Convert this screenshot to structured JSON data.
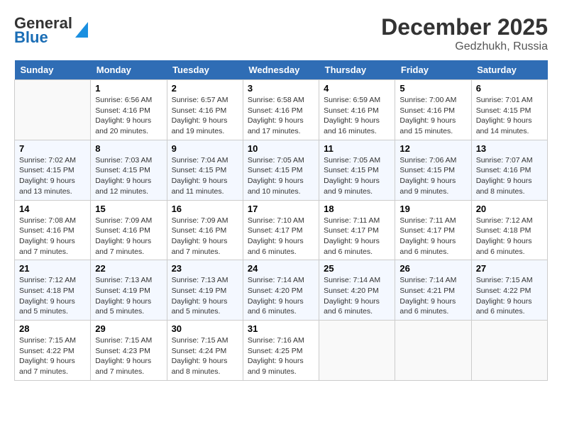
{
  "header": {
    "logo_line1": "General",
    "logo_line2": "Blue",
    "month": "December 2025",
    "location": "Gedzhukh, Russia"
  },
  "weekdays": [
    "Sunday",
    "Monday",
    "Tuesday",
    "Wednesday",
    "Thursday",
    "Friday",
    "Saturday"
  ],
  "weeks": [
    [
      {
        "date": "",
        "sunrise": "",
        "sunset": "",
        "daylight": ""
      },
      {
        "date": "1",
        "sunrise": "Sunrise: 6:56 AM",
        "sunset": "Sunset: 4:16 PM",
        "daylight": "Daylight: 9 hours and 20 minutes."
      },
      {
        "date": "2",
        "sunrise": "Sunrise: 6:57 AM",
        "sunset": "Sunset: 4:16 PM",
        "daylight": "Daylight: 9 hours and 19 minutes."
      },
      {
        "date": "3",
        "sunrise": "Sunrise: 6:58 AM",
        "sunset": "Sunset: 4:16 PM",
        "daylight": "Daylight: 9 hours and 17 minutes."
      },
      {
        "date": "4",
        "sunrise": "Sunrise: 6:59 AM",
        "sunset": "Sunset: 4:16 PM",
        "daylight": "Daylight: 9 hours and 16 minutes."
      },
      {
        "date": "5",
        "sunrise": "Sunrise: 7:00 AM",
        "sunset": "Sunset: 4:16 PM",
        "daylight": "Daylight: 9 hours and 15 minutes."
      },
      {
        "date": "6",
        "sunrise": "Sunrise: 7:01 AM",
        "sunset": "Sunset: 4:15 PM",
        "daylight": "Daylight: 9 hours and 14 minutes."
      }
    ],
    [
      {
        "date": "7",
        "sunrise": "Sunrise: 7:02 AM",
        "sunset": "Sunset: 4:15 PM",
        "daylight": "Daylight: 9 hours and 13 minutes."
      },
      {
        "date": "8",
        "sunrise": "Sunrise: 7:03 AM",
        "sunset": "Sunset: 4:15 PM",
        "daylight": "Daylight: 9 hours and 12 minutes."
      },
      {
        "date": "9",
        "sunrise": "Sunrise: 7:04 AM",
        "sunset": "Sunset: 4:15 PM",
        "daylight": "Daylight: 9 hours and 11 minutes."
      },
      {
        "date": "10",
        "sunrise": "Sunrise: 7:05 AM",
        "sunset": "Sunset: 4:15 PM",
        "daylight": "Daylight: 9 hours and 10 minutes."
      },
      {
        "date": "11",
        "sunrise": "Sunrise: 7:05 AM",
        "sunset": "Sunset: 4:15 PM",
        "daylight": "Daylight: 9 hours and 9 minutes."
      },
      {
        "date": "12",
        "sunrise": "Sunrise: 7:06 AM",
        "sunset": "Sunset: 4:15 PM",
        "daylight": "Daylight: 9 hours and 9 minutes."
      },
      {
        "date": "13",
        "sunrise": "Sunrise: 7:07 AM",
        "sunset": "Sunset: 4:16 PM",
        "daylight": "Daylight: 9 hours and 8 minutes."
      }
    ],
    [
      {
        "date": "14",
        "sunrise": "Sunrise: 7:08 AM",
        "sunset": "Sunset: 4:16 PM",
        "daylight": "Daylight: 9 hours and 7 minutes."
      },
      {
        "date": "15",
        "sunrise": "Sunrise: 7:09 AM",
        "sunset": "Sunset: 4:16 PM",
        "daylight": "Daylight: 9 hours and 7 minutes."
      },
      {
        "date": "16",
        "sunrise": "Sunrise: 7:09 AM",
        "sunset": "Sunset: 4:16 PM",
        "daylight": "Daylight: 9 hours and 7 minutes."
      },
      {
        "date": "17",
        "sunrise": "Sunrise: 7:10 AM",
        "sunset": "Sunset: 4:17 PM",
        "daylight": "Daylight: 9 hours and 6 minutes."
      },
      {
        "date": "18",
        "sunrise": "Sunrise: 7:11 AM",
        "sunset": "Sunset: 4:17 PM",
        "daylight": "Daylight: 9 hours and 6 minutes."
      },
      {
        "date": "19",
        "sunrise": "Sunrise: 7:11 AM",
        "sunset": "Sunset: 4:17 PM",
        "daylight": "Daylight: 9 hours and 6 minutes."
      },
      {
        "date": "20",
        "sunrise": "Sunrise: 7:12 AM",
        "sunset": "Sunset: 4:18 PM",
        "daylight": "Daylight: 9 hours and 6 minutes."
      }
    ],
    [
      {
        "date": "21",
        "sunrise": "Sunrise: 7:12 AM",
        "sunset": "Sunset: 4:18 PM",
        "daylight": "Daylight: 9 hours and 5 minutes."
      },
      {
        "date": "22",
        "sunrise": "Sunrise: 7:13 AM",
        "sunset": "Sunset: 4:19 PM",
        "daylight": "Daylight: 9 hours and 5 minutes."
      },
      {
        "date": "23",
        "sunrise": "Sunrise: 7:13 AM",
        "sunset": "Sunset: 4:19 PM",
        "daylight": "Daylight: 9 hours and 5 minutes."
      },
      {
        "date": "24",
        "sunrise": "Sunrise: 7:14 AM",
        "sunset": "Sunset: 4:20 PM",
        "daylight": "Daylight: 9 hours and 6 minutes."
      },
      {
        "date": "25",
        "sunrise": "Sunrise: 7:14 AM",
        "sunset": "Sunset: 4:20 PM",
        "daylight": "Daylight: 9 hours and 6 minutes."
      },
      {
        "date": "26",
        "sunrise": "Sunrise: 7:14 AM",
        "sunset": "Sunset: 4:21 PM",
        "daylight": "Daylight: 9 hours and 6 minutes."
      },
      {
        "date": "27",
        "sunrise": "Sunrise: 7:15 AM",
        "sunset": "Sunset: 4:22 PM",
        "daylight": "Daylight: 9 hours and 6 minutes."
      }
    ],
    [
      {
        "date": "28",
        "sunrise": "Sunrise: 7:15 AM",
        "sunset": "Sunset: 4:22 PM",
        "daylight": "Daylight: 9 hours and 7 minutes."
      },
      {
        "date": "29",
        "sunrise": "Sunrise: 7:15 AM",
        "sunset": "Sunset: 4:23 PM",
        "daylight": "Daylight: 9 hours and 7 minutes."
      },
      {
        "date": "30",
        "sunrise": "Sunrise: 7:15 AM",
        "sunset": "Sunset: 4:24 PM",
        "daylight": "Daylight: 9 hours and 8 minutes."
      },
      {
        "date": "31",
        "sunrise": "Sunrise: 7:16 AM",
        "sunset": "Sunset: 4:25 PM",
        "daylight": "Daylight: 9 hours and 9 minutes."
      },
      {
        "date": "",
        "sunrise": "",
        "sunset": "",
        "daylight": ""
      },
      {
        "date": "",
        "sunrise": "",
        "sunset": "",
        "daylight": ""
      },
      {
        "date": "",
        "sunrise": "",
        "sunset": "",
        "daylight": ""
      }
    ]
  ]
}
